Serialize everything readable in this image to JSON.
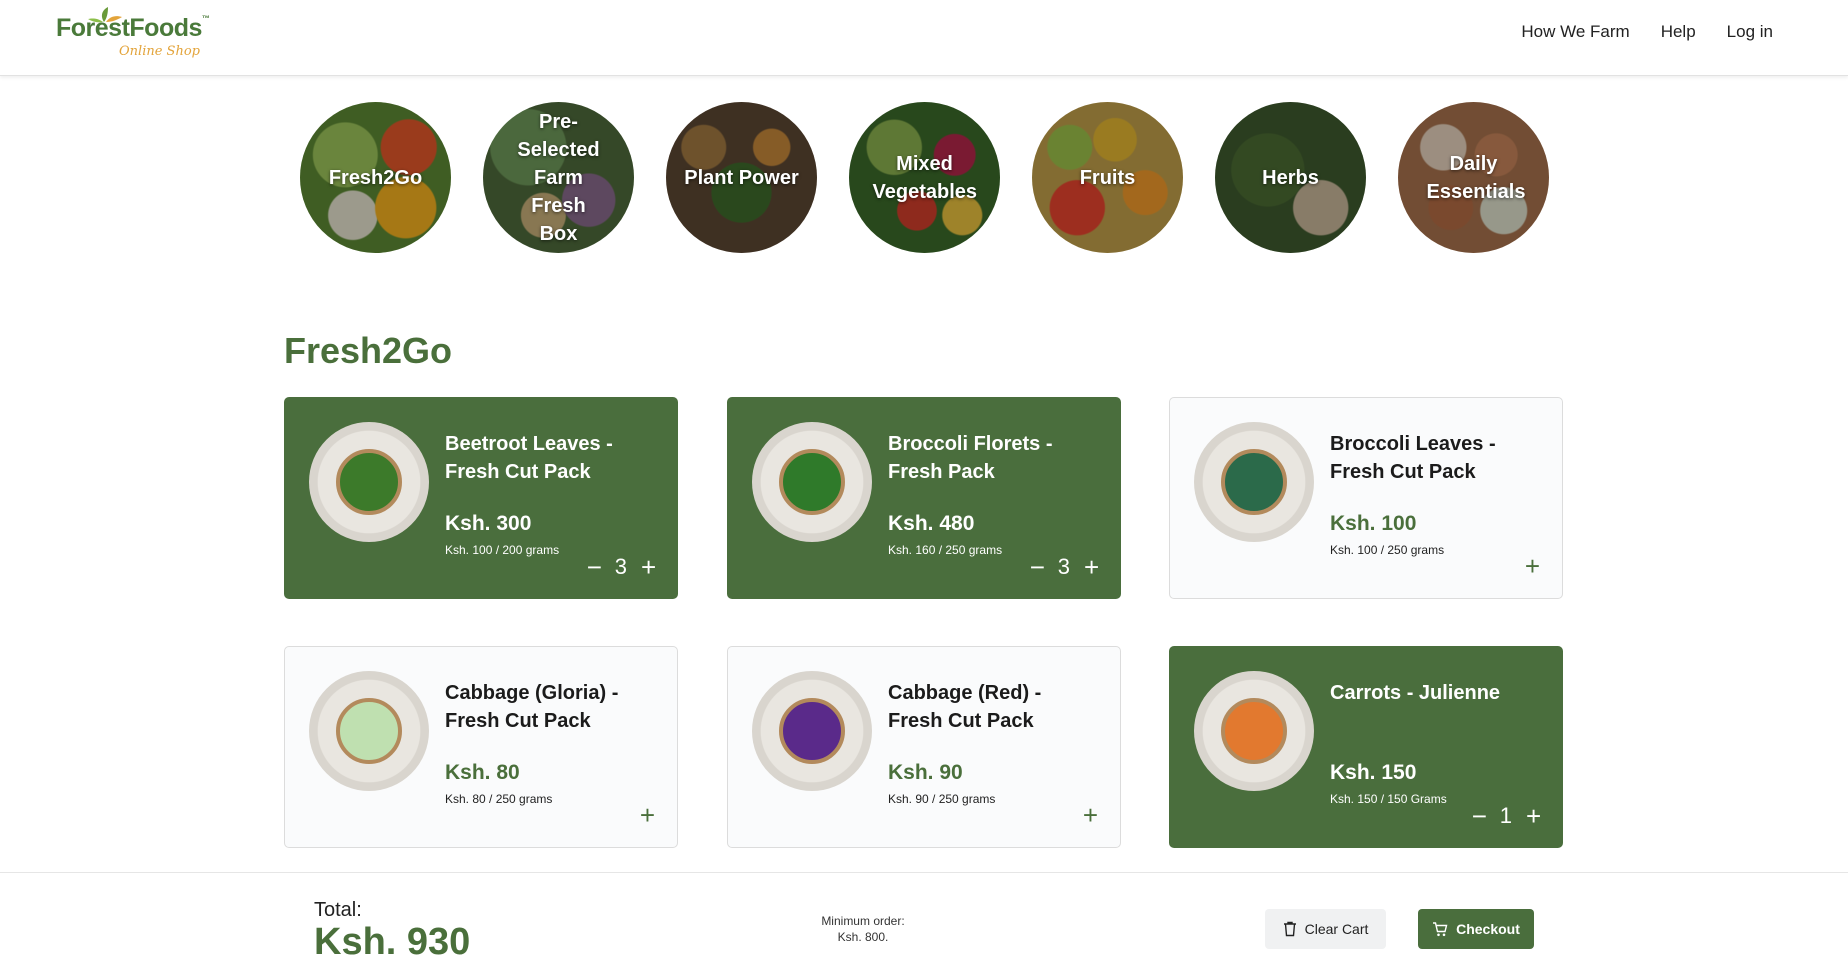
{
  "header": {
    "brand": "ForestFoods",
    "tm": "™",
    "tagline": "Online Shop",
    "nav": [
      "How We Farm",
      "Help",
      "Log in"
    ]
  },
  "categories": [
    {
      "label": "Fresh2Go"
    },
    {
      "label": "Pre-Selected Farm Fresh Box"
    },
    {
      "label": "Plant Power"
    },
    {
      "label": "Mixed Vegetables"
    },
    {
      "label": "Fruits"
    },
    {
      "label": "Herbs"
    },
    {
      "label": "Daily Essentials"
    }
  ],
  "section": {
    "title": "Fresh2Go"
  },
  "products": [
    {
      "name": "Beetroot Leaves - Fresh Cut Pack",
      "price": "Ksh. 300",
      "unit": "Ksh. 100 / 200 grams",
      "qty": "3",
      "in_cart": true,
      "content_color": "#3c7a2a"
    },
    {
      "name": "Broccoli Florets - Fresh Pack",
      "price": "Ksh. 480",
      "unit": "Ksh. 160 / 250 grams",
      "qty": "3",
      "in_cart": true,
      "content_color": "#2f7a2a"
    },
    {
      "name": "Broccoli Leaves - Fresh Cut Pack",
      "price": "Ksh. 100",
      "unit": "Ksh. 100 / 250 grams",
      "qty": "",
      "in_cart": false,
      "content_color": "#2b6a4a"
    },
    {
      "name": "Cabbage (Gloria) - Fresh Cut Pack",
      "price": "Ksh. 80",
      "unit": "Ksh. 80 / 250 grams",
      "qty": "",
      "in_cart": false,
      "content_color": "#bfe0b0"
    },
    {
      "name": "Cabbage (Red) - Fresh Cut Pack",
      "price": "Ksh. 90",
      "unit": "Ksh. 90 / 250 grams",
      "qty": "",
      "in_cart": false,
      "content_color": "#5a2a8a"
    },
    {
      "name": "Carrots - Julienne",
      "price": "Ksh. 150",
      "unit": "Ksh. 150 / 150 Grams",
      "qty": "1",
      "in_cart": true,
      "content_color": "#e2792f"
    }
  ],
  "stepper": {
    "minus": "−",
    "plus": "+"
  },
  "footer": {
    "total_label": "Total:",
    "total_value": "Ksh. 930",
    "min_order_line1": "Minimum order:",
    "min_order_line2": "Ksh. 800.",
    "clear_label": "Clear Cart",
    "checkout_label": "Checkout"
  },
  "colors": {
    "brand_green": "#4a6e3d",
    "accent_orange": "#e3a43b"
  }
}
